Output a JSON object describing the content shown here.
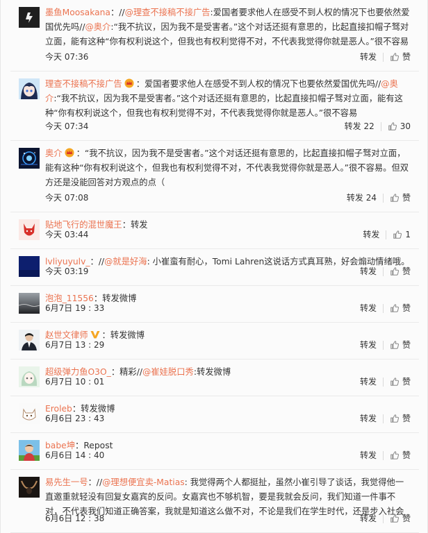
{
  "comments": [
    {
      "user": "墨鱼Moosakana",
      "body": [
        {
          "t": "text",
          "v": "：//"
        },
        {
          "t": "mention",
          "v": "@理查不接稿不接广告"
        },
        {
          "t": "text",
          "v": ":爱国者要求他人在感受不到人权的情况下也要依然爱国优先吗//"
        },
        {
          "t": "mention",
          "v": "@奥介"
        },
        {
          "t": "text",
          "v": ":“我不抗议，因为我不是受害者。”这个对话还挺有意思的，比起直接扣帽子驽对立面，能有这种“你有权利说这个，但我也有权利觉得不对，不代表我觉得你就是恶人。”很不容易"
        }
      ],
      "time": "今天 07:36",
      "repost_label": "转发",
      "repost_count": "",
      "like_label": "赞",
      "badge": ""
    },
    {
      "user": "理查不接稿不接广告",
      "body": [
        {
          "t": "text",
          "v": "：爱国者要求他人在感受不到人权的情况下也要依然爱国优先吗//"
        },
        {
          "t": "mention",
          "v": "@奥介"
        },
        {
          "t": "text",
          "v": ":“我不抗议，因为我不是受害者。”这个对话还挺有意思的，比起直接扣帽子驽对立面，能有这种“你有权利说这个，但我也有权利觉得不对，不代表我觉得你就是恶人。”很不容易"
        }
      ],
      "time": "今天 07:34",
      "repost_label": "转发",
      "repost_count": "22",
      "like_label": "30",
      "badge": "crown"
    },
    {
      "user": "奥介",
      "body": [
        {
          "t": "text",
          "v": "：“我不抗议，因为我不是受害者。”这个对话还挺有意思的，比起直接扣帽子驽对立面，能有这种“你有权利说这个，但我也有权利觉得不对，不代表我觉得你就是恶人。”很不容易。但双方还是没能回答对方观点的点（"
        }
      ],
      "time": "今天 07:08",
      "repost_label": "转发",
      "repost_count": "24",
      "like_label": "赞",
      "badge": "crown"
    },
    {
      "user": "贴地飞行的混世魔王",
      "body": [
        {
          "t": "text",
          "v": "：转发"
        }
      ],
      "time": "今天 03:44",
      "repost_label": "转发",
      "repost_count": "",
      "like_label": "1",
      "badge": ""
    },
    {
      "user": "lvliyuyulv_",
      "body": [
        {
          "t": "text",
          "v": "：//"
        },
        {
          "t": "mention",
          "v": "@就是好海"
        },
        {
          "t": "text",
          "v": ": 小崔蛮有耐心，Tomi Lahren这说话方式真耳熟，好会煽动情绪哦。"
        }
      ],
      "time": "今天 03:19",
      "repost_label": "转发",
      "repost_count": "",
      "like_label": "赞",
      "badge": ""
    },
    {
      "user": "泡泡_11556",
      "body": [
        {
          "t": "text",
          "v": "：转发微博"
        }
      ],
      "time": "6月7日 19 : 33",
      "repost_label": "转发",
      "repost_count": "",
      "like_label": "赞",
      "badge": ""
    },
    {
      "user": "赵世文律师",
      "body": [
        {
          "t": "text",
          "v": "：转发微博"
        }
      ],
      "time": "6月7日 13 : 29",
      "repost_label": "转发",
      "repost_count": "",
      "like_label": "赞",
      "badge": "v"
    },
    {
      "user": "超级弹力鱼O3O_",
      "body": [
        {
          "t": "text",
          "v": "：精彩//"
        },
        {
          "t": "mention",
          "v": "@崔娃脱口秀"
        },
        {
          "t": "text",
          "v": ":转发微博"
        }
      ],
      "time": "6月7日 10 : 01",
      "repost_label": "转发",
      "repost_count": "",
      "like_label": "赞",
      "badge": ""
    },
    {
      "user": "Eroleb",
      "body": [
        {
          "t": "text",
          "v": "：转发微博"
        }
      ],
      "time": "6月6日 23 : 43",
      "repost_label": "转发",
      "repost_count": "",
      "like_label": "赞",
      "badge": ""
    },
    {
      "user": "babe坤",
      "body": [
        {
          "t": "text",
          "v": "：Repost"
        }
      ],
      "time": "6月6日 14 : 40",
      "repost_label": "转发",
      "repost_count": "",
      "like_label": "赞",
      "badge": ""
    },
    {
      "user": "易先生一号",
      "body": [
        {
          "t": "text",
          "v": "：//"
        },
        {
          "t": "mention",
          "v": "@理想便宜卖-Matias"
        },
        {
          "t": "text",
          "v": ": 我觉得两个人都挺扯，虽然小崔引导了谈话，我觉得他一直邀重就轻没有回复女嘉宾的反问。女嘉宾也不够机智，要是我就会反问，我们知道一件事不对，不代表我们知道正确答案，我就是知道这么做不对，不论是我们在学生时代，还是步入社会"
        }
      ],
      "time": "6月6日 12 : 38",
      "repost_label": "转发",
      "repost_count": "",
      "like_label": "赞",
      "badge": ""
    }
  ],
  "colors": {
    "accent": "#eb7350",
    "text": "#333333",
    "divider": "#eaeaea",
    "vip_gold": "#f5a623"
  },
  "icons": {
    "like": "thumbs-up-icon",
    "crown": "crown-badge-icon",
    "verified": "verified-v-icon"
  }
}
